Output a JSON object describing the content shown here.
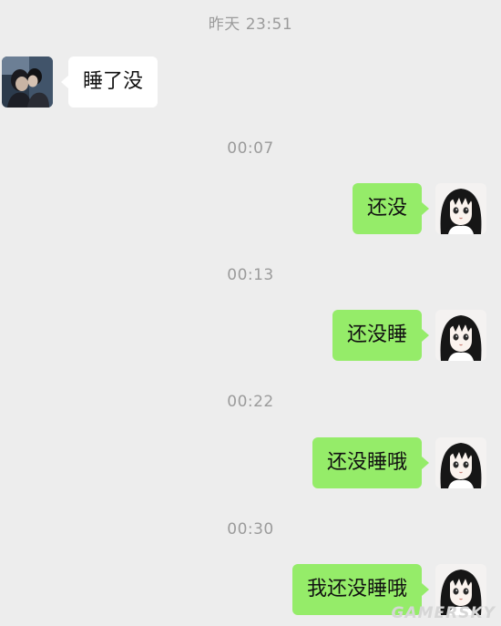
{
  "colors": {
    "background": "#ededed",
    "incoming_bubble": "#ffffff",
    "outgoing_bubble": "#95ec69",
    "timestamp_text": "#9b9b9b"
  },
  "messages": {
    "ts0": "昨天 23:51",
    "m0": "睡了没",
    "ts1": "00:07",
    "m1": "还没",
    "ts2": "00:13",
    "m2": "还没睡",
    "ts3": "00:22",
    "m3": "还没睡哦",
    "ts4": "00:30",
    "m4": "我还没睡哦"
  },
  "avatars": {
    "contact": "contact-avatar-photo",
    "self": "self-avatar-anime-girl"
  },
  "watermark": "GAMERSKY"
}
